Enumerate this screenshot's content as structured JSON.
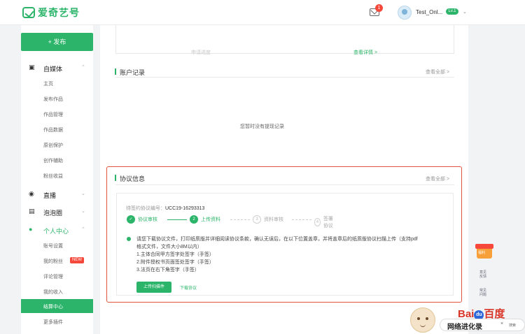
{
  "header": {
    "logo_text": "爱奇艺号",
    "mail_badge": "1",
    "username": "Test_Onl...",
    "level": "Lv.1"
  },
  "sidebar": {
    "publish_label": "+ 发布",
    "sections": [
      {
        "label": "自媒体",
        "icon": "media-icon"
      },
      {
        "label": "直播",
        "icon": "live-icon"
      },
      {
        "label": "泡泡圈",
        "icon": "bubble-icon"
      },
      {
        "label": "个人中心",
        "icon": "user-icon"
      }
    ],
    "media_items": [
      "主页",
      "发布作品",
      "作品管理",
      "作品数据",
      "原创保护",
      "创作辅助",
      "粉丝收益"
    ],
    "personal_items": [
      "账号设置",
      "我的粉丝",
      "评论管理",
      "我的收入",
      "结算中心",
      "更多插件"
    ],
    "fans_badge": "NEW"
  },
  "top_card": {
    "faded_text": "申请进度",
    "detail_link": "查看详情 >"
  },
  "account_card": {
    "title": "账户记录",
    "more": "查看全部 >",
    "empty": "您暂时没有提现记录"
  },
  "agreement_card": {
    "title": "协议信息",
    "more": "查看全部 >",
    "agreement_no_label": "待签约协议编号：",
    "agreement_no": "UCC19-16293313",
    "steps": [
      "协议审核",
      "上传资料",
      "资料审核",
      "签署协议"
    ],
    "instructions": [
      "请您下载协议文件，打印纸质版并详细阅读协议条款，确认无误后，在以下位置盖章，并将盖章后的纸质版协议扫描上传（支持pdf",
      "格式文件，文件大小8M以内）",
      "1.主体合同甲方签字处签字（手签）",
      "2.附件授权书页面签处签字（手签）",
      "3.法页在右下角签字（手签）"
    ],
    "upload_label": "上传扫描件",
    "download_label": "下载协议"
  },
  "floating": {
    "gift_text": "福利",
    "tool1": "意见\n反馈",
    "tool2": "常见\n问题"
  },
  "watermark": {
    "baidu_bai": "Bai",
    "baidu_du": "du",
    "baidu_zh": "百度",
    "bar_text": "网络进化录",
    "bar_close": "×",
    "bar_search": "搜索"
  }
}
